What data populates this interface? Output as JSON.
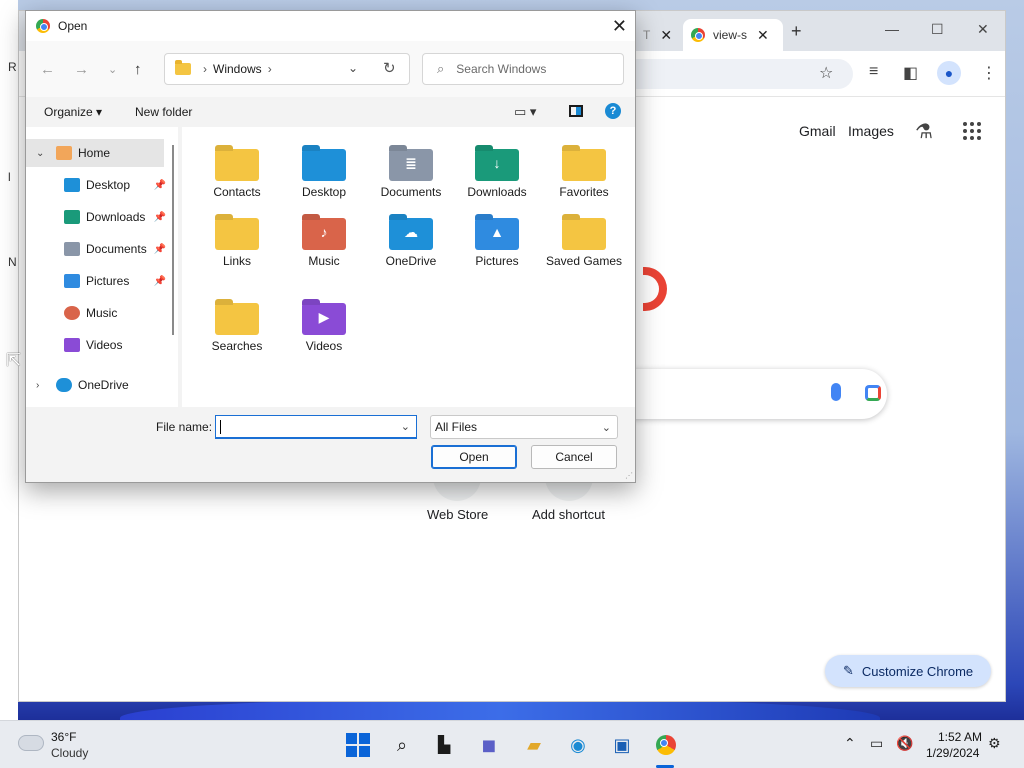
{
  "desktop": {
    "edge_marks": [
      "R",
      "l",
      "N"
    ]
  },
  "chrome": {
    "tabs": [
      {
        "label": "T"
      },
      {
        "label": "view-s"
      }
    ],
    "new_tab": "+",
    "win_controls": {
      "minimize": "—",
      "maximize": "☐",
      "close": "✕"
    },
    "header_links": {
      "gmail": "Gmail",
      "images": "Images"
    },
    "shortcuts": [
      {
        "label": "Web Store"
      },
      {
        "label": "Add shortcut"
      }
    ],
    "customize_label": "Customize Chrome",
    "accent": "#d3e3fd"
  },
  "dialog": {
    "title": "Open",
    "path": {
      "segment": "Windows"
    },
    "search_placeholder": "Search Windows",
    "commands": {
      "organize": "Organize ▾",
      "new_folder": "New folder"
    },
    "nav": [
      {
        "label": "Home",
        "icon": "home-icon",
        "selected": true
      },
      {
        "label": "Desktop",
        "icon": "desktop-icon",
        "pinned": true
      },
      {
        "label": "Downloads",
        "icon": "download-icon",
        "pinned": true
      },
      {
        "label": "Documents",
        "icon": "documents-icon",
        "pinned": true
      },
      {
        "label": "Pictures",
        "icon": "pictures-icon",
        "pinned": true
      },
      {
        "label": "Music",
        "icon": "music-icon"
      },
      {
        "label": "Videos",
        "icon": "videos-icon"
      },
      {
        "label": "OneDrive",
        "icon": "onedrive-icon"
      }
    ],
    "folders": [
      {
        "label": "Contacts",
        "color": "#f4c542",
        "glyph": ""
      },
      {
        "label": "Desktop",
        "color": "#1e90d8",
        "glyph": ""
      },
      {
        "label": "Documents",
        "color": "#8a96a8",
        "glyph": "≣"
      },
      {
        "label": "Downloads",
        "color": "#1a9a7a",
        "glyph": "↓"
      },
      {
        "label": "Favorites",
        "color": "#f4c542",
        "glyph": ""
      },
      {
        "label": "Links",
        "color": "#f4c542",
        "glyph": ""
      },
      {
        "label": "Music",
        "color": "#d9644a",
        "glyph": "♪"
      },
      {
        "label": "OneDrive",
        "color": "#1e90d8",
        "glyph": "☁"
      },
      {
        "label": "Pictures",
        "color": "#2f8be0",
        "glyph": "▲"
      },
      {
        "label": "Saved Games",
        "color": "#f4c542",
        "glyph": ""
      },
      {
        "label": "Searches",
        "color": "#f4c542",
        "glyph": ""
      },
      {
        "label": "Videos",
        "color": "#8a4bd6",
        "glyph": "▶"
      }
    ],
    "file_name_label": "File name:",
    "file_name_value": "",
    "filter_value": "All Files",
    "open_label": "Open",
    "cancel_label": "Cancel"
  },
  "taskbar": {
    "weather": {
      "temp": "36°F",
      "desc": "Cloudy"
    },
    "clock": {
      "time": "1:52 AM",
      "date": "1/29/2024"
    }
  }
}
